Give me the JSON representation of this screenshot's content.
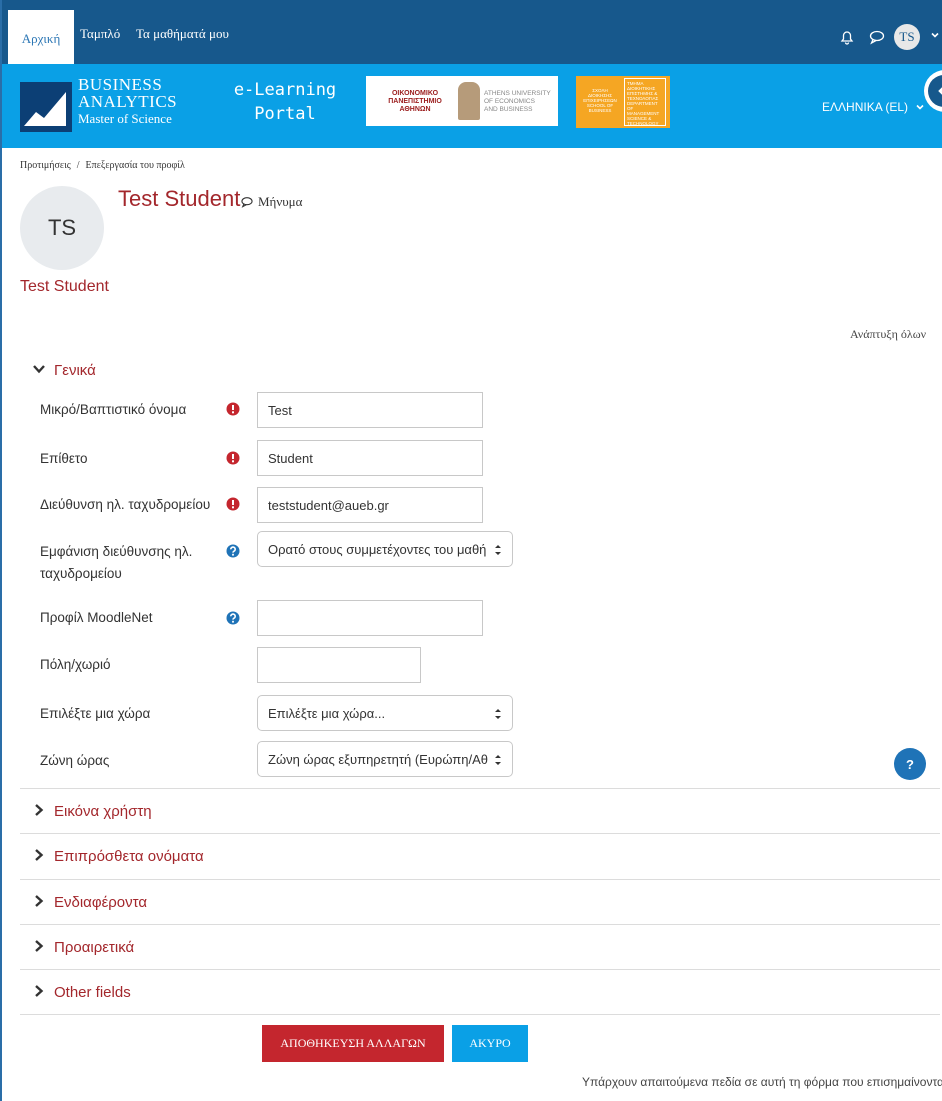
{
  "navbar": {
    "home": "Αρχική",
    "dashboard": "Ταμπλό",
    "my_courses": "Τα μαθήματά μου",
    "user_initials": "TS"
  },
  "banner": {
    "logo_line1": "BUSINESS",
    "logo_line2": "ANALYTICS",
    "logo_line3": "Master of Science",
    "portal_line1": "e-Learning",
    "portal_line2": "Portal",
    "aueb_gr_1": "ΟΙΚΟΝΟΜΙΚΟ",
    "aueb_gr_2": "ΠΑΝΕΠΙΣΤΗΜΙΟ",
    "aueb_gr_3": "ΑΘΗΝΩΝ",
    "aueb_en_1": "ATHENS UNIVERSITY",
    "aueb_en_2": "OF ECONOMICS",
    "aueb_en_3": "AND BUSINESS",
    "school_left": "ΣΧΟΛΗ ΔΙΟΙΚΗΣΗΣ ΕΠΙΧΕΙΡΗΣΕΩΝ SCHOOL OF BUSINESS",
    "school_right": "ΤΜΗΜΑ ΔΙΟΙΚΗΤΙΚΗΣ ΕΠΙΣΤΗΜΗΣ & ΤΕΧΝΟΛΟΓΙΑΣ DEPARTMENT OF MANAGEMENT SCIENCE & TECHNOLOGY",
    "language": "ΕΛΛΗΝΙΚΑ (EL)"
  },
  "breadcrumb": {
    "item1": "Προτιμήσεις",
    "separator": "/",
    "item2": "Επεξεργασία του προφίλ"
  },
  "profile": {
    "initials": "TS",
    "name": "Test Student",
    "message_link": "Μήνυμα",
    "name_below": "Test Student"
  },
  "expand_all": "Ανάπτυξη όλων",
  "general_section": {
    "title": "Γενικά",
    "fields": {
      "firstname_label": "Μικρό/Βαπτιστικό όνομα",
      "firstname_value": "Test",
      "lastname_label": "Επίθετο",
      "lastname_value": "Student",
      "email_label": "Διεύθυνση ηλ. ταχυδρομείου",
      "email_value": "teststudent@aueb.gr",
      "email_display_label_1": "Εμφάνιση διεύθυνσης ηλ.",
      "email_display_label_2": "ταχυδρομείου",
      "email_display_value": "Ορατό στους συμμετέχοντες του μαθή",
      "moodlenet_label": "Προφίλ MoodleNet",
      "moodlenet_value": "",
      "city_label": "Πόλη/χωριό",
      "city_value": "",
      "country_label": "Επιλέξτε μια χώρα",
      "country_value": "Επιλέξτε μια χώρα...",
      "timezone_label": "Ζώνη ώρας",
      "timezone_value": "Ζώνη ώρας εξυπηρετητή (Ευρώπη/Αθ"
    }
  },
  "help_button": "?",
  "collapsed_sections": {
    "user_picture": "Εικόνα χρήστη",
    "additional_names": "Επιπρόσθετα ονόματα",
    "interests": "Ενδιαφέροντα",
    "optional": "Προαιρετικά",
    "other_fields": "Other fields"
  },
  "buttons": {
    "save": "ΑΠΟΘΗΚΕΥΣΗ ΑΛΛΑΓΩΝ",
    "cancel": "ΑΚΥΡΟ"
  },
  "footer_note": "Υπάρχουν απαιτούμενα πεδία σε αυτή τη φόρμα που επισημαίνονται με",
  "footer_note_end": ".",
  "colors": {
    "navbar": "#17588c",
    "banner": "#0aa0e6",
    "accent_red": "#a3272c",
    "save_button": "#c4262e",
    "cancel_button": "#0aa0e6",
    "required_icon": "#c4262e",
    "help_icon": "#1f73b7"
  },
  "icons": {
    "bell": "bell-icon",
    "chat": "chat-bubble-icon",
    "required": "exclamation-circle-icon",
    "help": "question-circle-icon",
    "chevron_down": "chevron-down-icon",
    "chevron_right": "chevron-right-icon"
  }
}
